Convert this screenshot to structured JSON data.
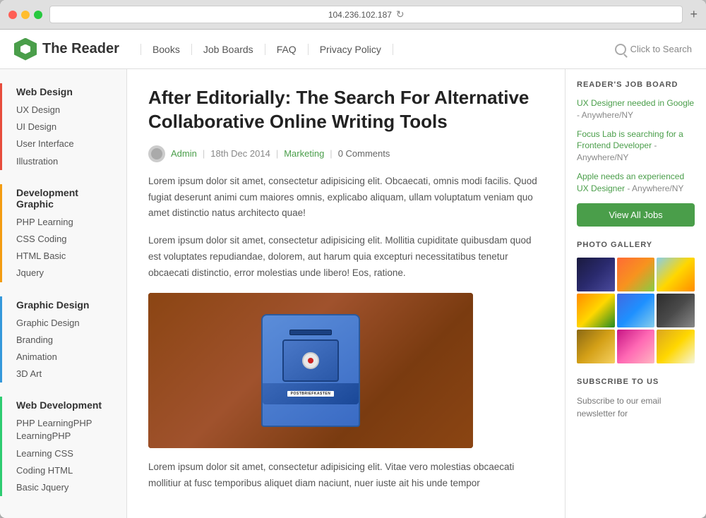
{
  "browser": {
    "address": "104.236.102.187",
    "traffic_lights": [
      "red",
      "yellow",
      "green"
    ]
  },
  "header": {
    "logo_text": "The Reader",
    "nav_items": [
      "Books",
      "Job Boards",
      "FAQ",
      "Privacy Policy"
    ],
    "search_placeholder": "Click to Search"
  },
  "sidebar": {
    "sections": [
      {
        "id": "web-design",
        "category": "Web Design",
        "items": [
          "UX Design",
          "UI Design",
          "User Interface",
          "Illustration"
        ]
      },
      {
        "id": "development-graphic",
        "category": "Development Graphic",
        "items": [
          "PHP Learning",
          "CSS Coding",
          "HTML Basic",
          "Jquery"
        ]
      },
      {
        "id": "graphic-design",
        "category": "Graphic Design",
        "items": [
          "Graphic Design",
          "Branding",
          "Animation",
          "3D Art"
        ]
      },
      {
        "id": "web-development",
        "category": "Web Development",
        "items": [
          "PHP LearningPHP LearningPHP",
          "Learning CSS",
          "Coding HTML",
          "Basic Jquery"
        ]
      }
    ]
  },
  "article": {
    "title": "After Editorially: The Search For Alternative Collaborative Online Writing Tools",
    "author": "Admin",
    "date": "18th Dec 2014",
    "category": "Marketing",
    "comments": "0 Comments",
    "body1": "Lorem ipsum dolor sit amet, consectetur adipisicing elit. Obcaecati, omnis modi facilis. Quod fugiat deserunt animi cum maiores omnis, explicabo aliquam, ullam voluptatum veniam quo amet distinctio natus architecto quae!",
    "body2": "Lorem ipsum dolor sit amet, consectetur adipisicing elit. Mollitia cupiditate quibusdam quod est voluptates repudiandae, dolorem, aut harum quia excepturi necessitatibus tenetur obcaecati distinctio, error molestias unde libero! Eos, ratione.",
    "body3": "Lorem ipsum dolor sit amet, consectetur adipisicing elit. Vitae vero molestias obcaecati mollitiur at fusc temporibus aliquet diam naciunt, nuer iuste ait his unde tempor",
    "image_label": "POSTBRIEFKASTEN"
  },
  "right_sidebar": {
    "job_board_title": "READER'S JOB BOARD",
    "jobs": [
      {
        "link": "UX Designer needed in Google",
        "loc": "- Anywhere/NY"
      },
      {
        "link": "Focus Lab is searching for a Frontend Developer",
        "loc": "- Anywhere/NY"
      },
      {
        "link": "Apple needs an experienced UX Designer",
        "loc": "- Anywhere/NY"
      }
    ],
    "view_jobs_label": "View All Jobs",
    "photo_gallery_title": "PHOTO GALLERY",
    "subscribe_title": "SUBSCRIBE TO US",
    "subscribe_text": "Subscribe to our email newsletter for"
  }
}
